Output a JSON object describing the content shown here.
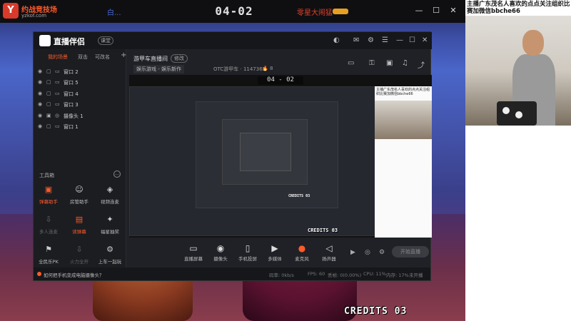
{
  "hud": {
    "logo_mark": "Y",
    "logo_name": "约战竞技场",
    "logo_url": "yzkof.com",
    "player1": "白...",
    "score": "04-02",
    "player2": "零星大闹猛",
    "win_min": "—",
    "win_max": "☐",
    "win_close": "✕"
  },
  "app": {
    "name": "直播伴侣",
    "tag": "课堂",
    "tabs": [
      "我的场景",
      "双击",
      "可改名"
    ],
    "add_tab": "+",
    "scenes": [
      {
        "label": "窗口 2"
      },
      {
        "label": "窗口 5"
      },
      {
        "label": "窗口 4"
      },
      {
        "label": "窗口 3"
      },
      {
        "label": "摄像头 1"
      },
      {
        "label": "窗口 1"
      }
    ],
    "tools_title": "工具箱",
    "tools_more": "…",
    "tools": [
      {
        "label": "弹幕助手",
        "icon": "▣",
        "hot": true,
        "dim": false
      },
      {
        "label": "房管助手",
        "icon": "☺",
        "hot": false,
        "dim": false
      },
      {
        "label": "视频连麦",
        "icon": "◈",
        "hot": false,
        "dim": false
      },
      {
        "label": "多人连麦",
        "icon": "⇩",
        "hot": false,
        "dim": true
      },
      {
        "label": "读弹幕",
        "icon": "▤",
        "hot": true,
        "dim": false
      },
      {
        "label": "福星抽奖",
        "icon": "✦",
        "hot": false,
        "dim": false
      },
      {
        "label": "全民乐PK",
        "icon": "⚑",
        "hot": false,
        "dim": false
      },
      {
        "label": "火力全开",
        "icon": "⇩",
        "hot": false,
        "dim": true
      },
      {
        "label": "上车一起玩",
        "icon": "⚙",
        "hot": false,
        "dim": false
      }
    ]
  },
  "room": {
    "name": "游甲车直播间",
    "tag": "修改",
    "category": "娱乐游戏 - 娱乐新作",
    "id_label": "OTC游甲车 · 1147365",
    "fire": "🔥 8"
  },
  "preview": {
    "score": "04 - 02",
    "credits_small": "CREDITS 03",
    "credits_xs": "CREDITS 03",
    "cam_text": "主播广东茂名人喜欢的点点关注组织比赛加微信bbche66"
  },
  "controls": [
    {
      "label": "直播屏幕",
      "icon": "▭"
    },
    {
      "label": "摄像头",
      "icon": "◉"
    },
    {
      "label": "手机投屏",
      "icon": "▯"
    },
    {
      "label": "多媒体",
      "icon": "▶"
    },
    {
      "label": "麦克风",
      "icon": "●"
    },
    {
      "label": "扬声器",
      "icon": "◁"
    }
  ],
  "start_label": "开始直播",
  "status": {
    "tip": "如何把手机变成电脑摄像头？",
    "bitrate": "码率: 0kb/s",
    "fps": "FPS: 60",
    "drop": "丢帧: 0(0.00%)",
    "cpu": "CPU: 11%",
    "mem": "内存: 17%",
    "net": "未开播"
  },
  "webcam": {
    "caption": "主播广东茂名人喜欢的点点关注组织比赛加微信bbche66"
  },
  "game": {
    "credits": "CREDITS 03"
  }
}
